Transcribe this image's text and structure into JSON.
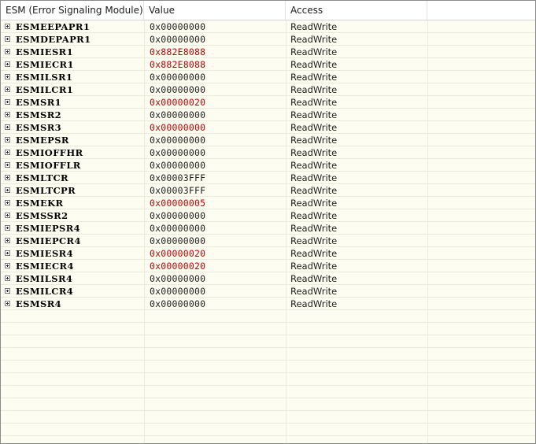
{
  "header": {
    "col_name": "ESM (Error Signaling Module)",
    "col_value": "Value",
    "col_access": "Access"
  },
  "colors": {
    "background": "#fdfdf1",
    "value_normal": "#1e1e1e",
    "value_changed": "#c00000"
  },
  "icons": {
    "expander": "plus-box-icon"
  },
  "registers": [
    {
      "name": "ESMEEPAPR1",
      "value": "0x00000000",
      "access": "ReadWrite",
      "changed": false
    },
    {
      "name": "ESMDEPAPR1",
      "value": "0x00000000",
      "access": "ReadWrite",
      "changed": false
    },
    {
      "name": "ESMIESR1",
      "value": "0x882E8088",
      "access": "ReadWrite",
      "changed": true
    },
    {
      "name": "ESMIECR1",
      "value": "0x882E8088",
      "access": "ReadWrite",
      "changed": true
    },
    {
      "name": "ESMILSR1",
      "value": "0x00000000",
      "access": "ReadWrite",
      "changed": false
    },
    {
      "name": "ESMILCR1",
      "value": "0x00000000",
      "access": "ReadWrite",
      "changed": false
    },
    {
      "name": "ESMSR1",
      "value": "0x00000020",
      "access": "ReadWrite",
      "changed": true
    },
    {
      "name": "ESMSR2",
      "value": "0x00000000",
      "access": "ReadWrite",
      "changed": false
    },
    {
      "name": "ESMSR3",
      "value": "0x00000000",
      "access": "ReadWrite",
      "changed": true
    },
    {
      "name": "ESMEPSR",
      "value": "0x00000000",
      "access": "ReadWrite",
      "changed": false
    },
    {
      "name": "ESMIOFFHR",
      "value": "0x00000000",
      "access": "ReadWrite",
      "changed": false
    },
    {
      "name": "ESMIOFFLR",
      "value": "0x00000000",
      "access": "ReadWrite",
      "changed": false
    },
    {
      "name": "ESMLTCR",
      "value": "0x00003FFF",
      "access": "ReadWrite",
      "changed": false
    },
    {
      "name": "ESMLTCPR",
      "value": "0x00003FFF",
      "access": "ReadWrite",
      "changed": false
    },
    {
      "name": "ESMEKR",
      "value": "0x00000005",
      "access": "ReadWrite",
      "changed": true
    },
    {
      "name": "ESMSSR2",
      "value": "0x00000000",
      "access": "ReadWrite",
      "changed": false
    },
    {
      "name": "ESMIEPSR4",
      "value": "0x00000000",
      "access": "ReadWrite",
      "changed": false
    },
    {
      "name": "ESMIEPCR4",
      "value": "0x00000000",
      "access": "ReadWrite",
      "changed": false
    },
    {
      "name": "ESMIESR4",
      "value": "0x00000020",
      "access": "ReadWrite",
      "changed": true
    },
    {
      "name": "ESMIECR4",
      "value": "0x00000020",
      "access": "ReadWrite",
      "changed": true
    },
    {
      "name": "ESMILSR4",
      "value": "0x00000000",
      "access": "ReadWrite",
      "changed": false
    },
    {
      "name": "ESMILCR4",
      "value": "0x00000000",
      "access": "ReadWrite",
      "changed": false
    },
    {
      "name": "ESMSR4",
      "value": "0x00000000",
      "access": "ReadWrite",
      "changed": false
    }
  ]
}
